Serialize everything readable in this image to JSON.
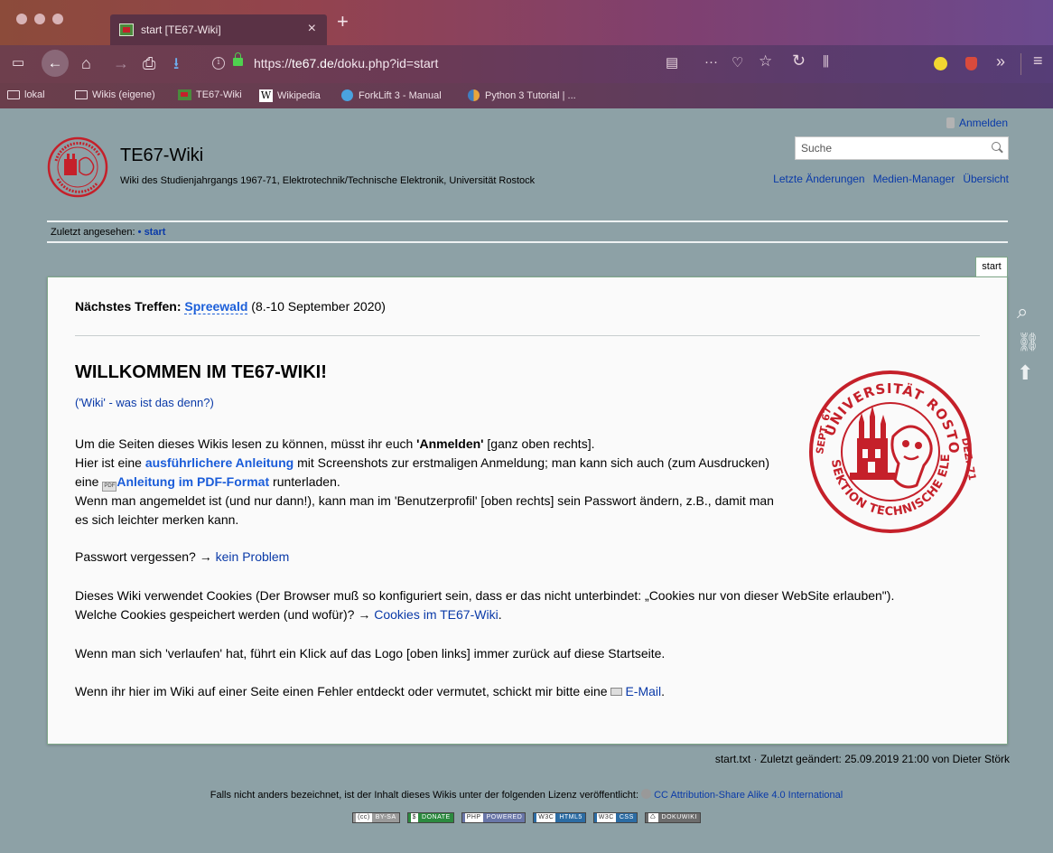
{
  "browser": {
    "tab_title": "start [TE67-Wiki]",
    "tab_close": "×",
    "new_tab": "+",
    "url_scheme": "https://",
    "url_host": "te67.de",
    "url_path": "/doku.php?id=start",
    "bookmarks": [
      {
        "label": "lokal",
        "icon": "folder-icon"
      },
      {
        "label": "Wikis (eigene)",
        "icon": "folder-icon"
      },
      {
        "label": "TE67-Wiki",
        "icon": "te67-favicon"
      },
      {
        "label": "Wikipedia",
        "icon": "wikipedia-icon"
      },
      {
        "label": "ForkLift 3 - Manual",
        "icon": "forklift-icon"
      },
      {
        "label": "Python 3 Tutorial | ...",
        "icon": "python-icon"
      }
    ],
    "icons": {
      "sidebar": "▭",
      "back": "←",
      "home": "⌂",
      "forward": "→",
      "print": "⎙",
      "download": "⭳",
      "reader": "▤",
      "more": "···",
      "pocket": "♡",
      "star": "☆",
      "reload": "↻",
      "library": "⫼",
      "overflow": "»",
      "menu": "≡"
    }
  },
  "wiki": {
    "login_label": "Anmelden",
    "search_placeholder": "Suche",
    "toolnav": [
      "Letzte Änderungen",
      "Medien-Manager",
      "Übersicht"
    ],
    "title": "TE67-Wiki",
    "tagline": "Wiki des Studienjahrgangs 1967-71, Elektrotechnik/Technische Elektronik, Universität Rostock",
    "breadcrumb_label": "Zuletzt angesehen:",
    "breadcrumb_sep": "•",
    "breadcrumb_item": "start",
    "page_tab": "start"
  },
  "content": {
    "meeting_label": "Nächstes Treffen:",
    "meeting_link": "Spreewald",
    "meeting_date": "(8.-10 September 2020)",
    "heading": "WILLKOMMEN IM TE67-WIKI!",
    "what_link": "('Wiki' - was ist das denn?)",
    "p1_a": "Um die Seiten dieses Wikis lesen zu können, müsst ihr euch ",
    "p1_b": "'Anmelden'",
    "p1_c": " [ganz oben rechts].",
    "p2_a": "Hier ist eine ",
    "p2_link": "ausführlichere Anleitung",
    "p2_b": " mit Screenshots zur erstmaligen Anmeldung; man kann sich auch (zum Ausdrucken) eine ",
    "p2_pdf_icon": "PDF",
    "p2_pdf_link": "Anleitung im PDF-Format",
    "p2_c": " runterladen.",
    "p3": "Wenn man angemeldet ist (und nur dann!), kann man im 'Benutzerprofil' [oben rechts] sein Passwort ändern, z.B., damit man es sich leichter merken kann.",
    "pw_text": "Passwort vergessen? → ",
    "pw_link": "kein Problem",
    "cookies_text": "Dieses Wiki verwendet Cookies (Der Browser muß so konfiguriert sein, dass er das nicht unterbindet: „Cookies nur von dieser WebSite erlauben\").",
    "cookies_q": "Welche Cookies gespeichert werden (und wofür)? → ",
    "cookies_link": "Cookies im TE67-Wiki",
    "cookies_end": ".",
    "lost_text": "Wenn man sich 'verlaufen' hat, führt ein Klick auf das Logo [oben links] immer zurück auf diese Startseite.",
    "error_text": "Wenn ihr hier im Wiki auf einer Seite einen Fehler entdeckt oder vermutet, schickt mir bitte eine ",
    "error_link": "E-Mail",
    "error_end": "."
  },
  "seal_text": {
    "top": "UNIVERSITÄT ROSTOCK",
    "left": "SEPT. 67",
    "right": "DEZ. 71",
    "bottom": "SEKTION TECHNISCHE ELEKTRONIK"
  },
  "footer": {
    "lastmod": "start.txt · Zuletzt geändert: 25.09.2019 21:00 von Dieter Störk",
    "license_text": "Falls nicht anders bezeichnet, ist der Inhalt dieses Wikis unter der folgenden Lizenz veröffentlicht: ",
    "license_link": "CC Attribution-Share Alike 4.0 International",
    "badges": [
      {
        "k": "(cc)",
        "v": "BY-SA",
        "color": "#9a9a9a"
      },
      {
        "k": "$",
        "v": "DONATE",
        "color": "#2c8a3f"
      },
      {
        "k": "PHP",
        "v": "POWERED",
        "color": "#6976a8"
      },
      {
        "k": "W3C",
        "v": "HTML5",
        "color": "#2c6ca3"
      },
      {
        "k": "W3C",
        "v": "CSS",
        "color": "#2c6ca3"
      },
      {
        "k": "♺",
        "v": "DOKUWIKI",
        "color": "#6c6c6c"
      }
    ]
  },
  "colors": {
    "page_bg": "#8da1a6",
    "link": "#0a3aa8",
    "seal_red": "#c5202a"
  }
}
